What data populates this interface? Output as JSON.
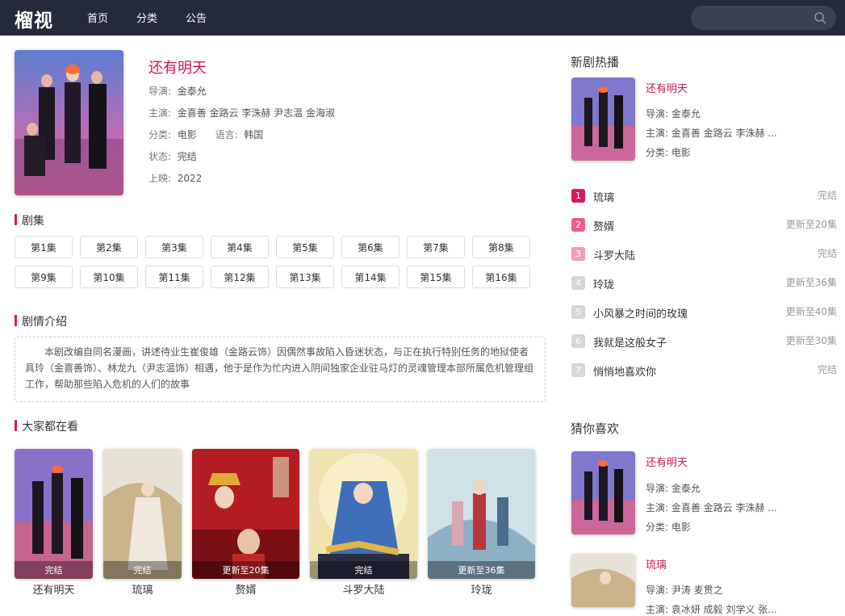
{
  "header": {
    "logo": "榴视",
    "nav": [
      "首页",
      "分类",
      "公告"
    ],
    "search_placeholder": ""
  },
  "detail": {
    "title": "还有明天",
    "director_label": "导演:",
    "director": "金泰允",
    "cast_label": "主演:",
    "cast": "金喜善 金路云 李洙赫 尹志温 金海淑",
    "category_label": "分类:",
    "category": "电影",
    "language_label": "语言:",
    "language": "韩国",
    "status_label": "状态:",
    "status": "完结",
    "year_label": "上映:",
    "year": "2022"
  },
  "episodes": {
    "heading": "剧集",
    "items": [
      "第1集",
      "第2集",
      "第3集",
      "第4集",
      "第5集",
      "第6集",
      "第7集",
      "第8集",
      "第9集",
      "第10集",
      "第11集",
      "第12集",
      "第13集",
      "第14集",
      "第15集",
      "第16集"
    ]
  },
  "plot": {
    "heading": "剧情介绍",
    "text": "本剧改编自同名漫画，讲述待业生崔俊雄（金路云饰）因偶然事故陷入昏迷状态，与正在执行特别任务的地狱使者具玲（金喜善饰）、林龙九（尹志温饰）相遇，他于是作为忙内进入阴间独家企业驻马灯的灵魂管理本部所属危机管理组工作，帮助那些陷入危机的人们的故事"
  },
  "popular": {
    "heading": "大家都在看",
    "cards": [
      {
        "title": "还有明天",
        "badge": "完结"
      },
      {
        "title": "琉璃",
        "badge": "完结"
      },
      {
        "title": "赘婿",
        "badge": "更新至20集"
      },
      {
        "title": "斗罗大陆",
        "badge": "完结"
      },
      {
        "title": "玲珑",
        "badge": "更新至36集"
      }
    ]
  },
  "sidebar": {
    "hot_heading": "新剧热播",
    "hot_feature": {
      "title": "还有明天",
      "director": "导演: 金泰允",
      "cast": "主演: 金喜善 金路云 李洙赫 ...",
      "category": "分类: 电影"
    },
    "rank": [
      {
        "num": "1",
        "name": "琉璃",
        "status": "完结",
        "color": "#d6185f"
      },
      {
        "num": "2",
        "name": "赘婿",
        "status": "更新至20集",
        "color": "#ec5c93"
      },
      {
        "num": "3",
        "name": "斗罗大陆",
        "status": "完结",
        "color": "#f19bbd"
      },
      {
        "num": "4",
        "name": "玲珑",
        "status": "更新至36集",
        "color": "#d6d6d6"
      },
      {
        "num": "5",
        "name": "小风暴之时间的玫瑰",
        "status": "更新至40集",
        "color": "#d6d6d6"
      },
      {
        "num": "6",
        "name": "我就是这般女子",
        "status": "更新至30集",
        "color": "#d6d6d6"
      },
      {
        "num": "7",
        "name": "悄悄地喜欢你",
        "status": "完结",
        "color": "#d6d6d6"
      }
    ],
    "guess_heading": "猜你喜欢",
    "guess": [
      {
        "title": "还有明天",
        "director": "导演: 金泰允",
        "cast": "主演: 金喜善 金路云 李洙赫 ...",
        "category": "分类: 电影"
      },
      {
        "title": "琉璃",
        "director": "导演: 尹涛 麦贯之",
        "cast": "主演: 袁冰妍 成毅 刘学义 张..."
      }
    ]
  },
  "colors": {
    "accent": "#c8175d",
    "topbar": "#242a37"
  }
}
